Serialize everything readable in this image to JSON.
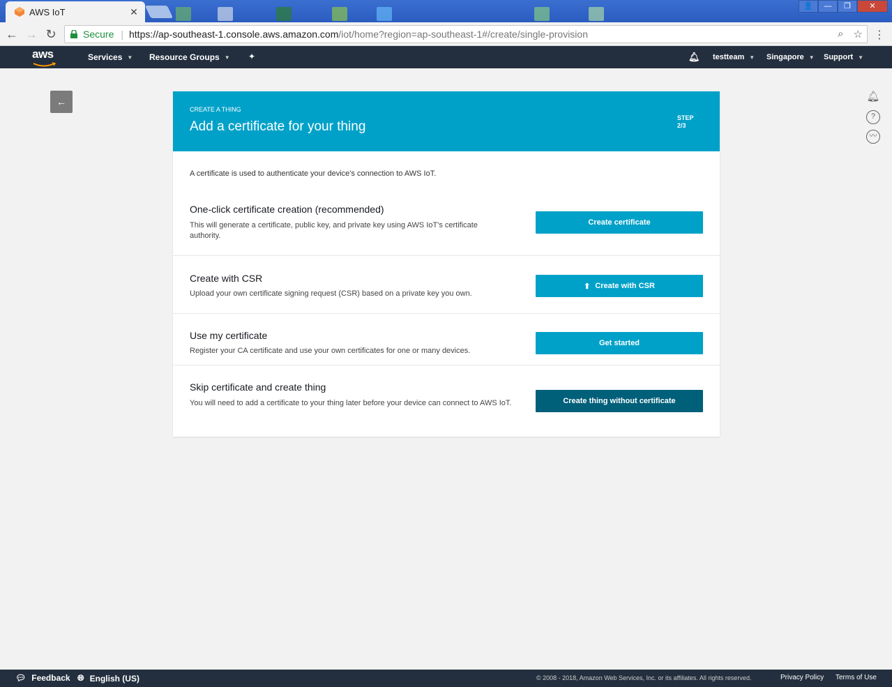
{
  "browser": {
    "tab_title": "AWS IoT",
    "secure_label": "Secure",
    "url_scheme_host": "https://ap-southeast-1.console.aws.amazon.com",
    "url_path": "/iot/home?region=ap-southeast-1#/create/single-provision"
  },
  "nav": {
    "logo_text": "aws",
    "services": "Services",
    "resource_groups": "Resource Groups",
    "account": "testteam",
    "region": "Singapore",
    "support": "Support"
  },
  "header": {
    "kicker": "CREATE A THING",
    "title": "Add a certificate for your thing",
    "step_label": "STEP",
    "step_value": "2/3"
  },
  "intro": "A certificate is used to authenticate your device's connection to AWS IoT.",
  "options": [
    {
      "title": "One-click certificate creation (recommended)",
      "description": "This will generate a certificate, public key, and private key using AWS IoT's certificate authority.",
      "button": "Create certificate"
    },
    {
      "title": "Create with CSR",
      "description": "Upload your own certificate signing request (CSR) based on a private key you own.",
      "button": "Create with CSR"
    },
    {
      "title": "Use my certificate",
      "description": "Register your CA certificate and use your own certificates for one or many devices.",
      "button": "Get started"
    },
    {
      "title": "Skip certificate and create thing",
      "description": "You will need to add a certificate to your thing later before your device can connect to AWS IoT.",
      "button": "Create thing without certificate"
    }
  ],
  "footer": {
    "feedback": "Feedback",
    "language": "English (US)",
    "copyright": "© 2008 - 2018, Amazon Web Services, Inc. or its affiliates. All rights reserved.",
    "privacy": "Privacy Policy",
    "terms": "Terms of Use"
  },
  "colors": {
    "header_blue": "#00a1c9",
    "dark_button": "#005f79",
    "nav_bg": "#232f3e"
  }
}
